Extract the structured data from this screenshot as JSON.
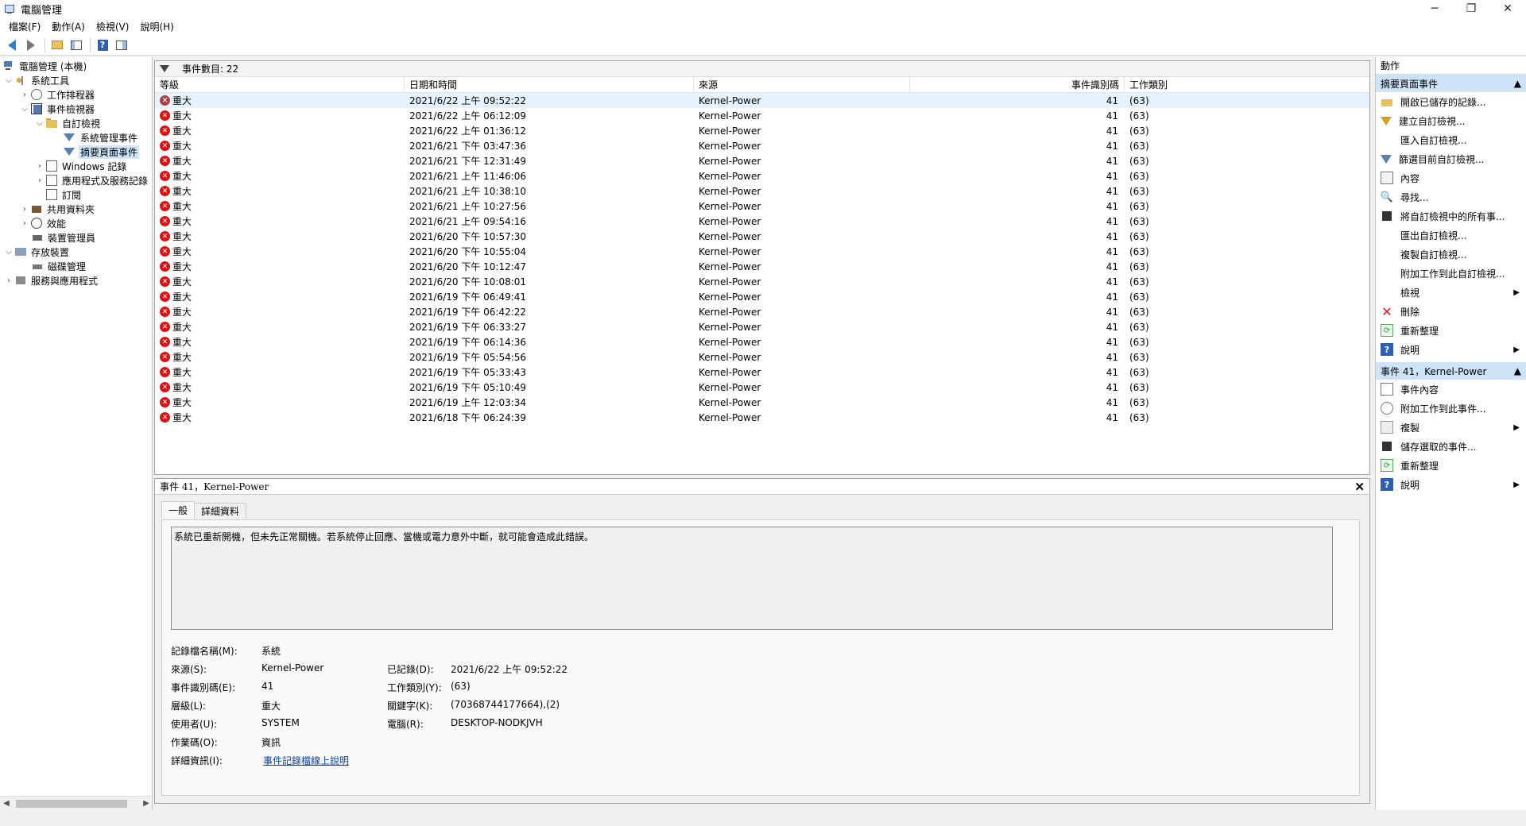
{
  "window": {
    "title": "電腦管理",
    "controls": [
      "─",
      "❐",
      "✕"
    ]
  },
  "menu": [
    "檔案(F)",
    "動作(A)",
    "檢視(V)",
    "說明(H)"
  ],
  "tree": [
    {
      "label": "電腦管理 (本機)",
      "chev": ""
    },
    {
      "label": "系統工具",
      "chev": "v"
    },
    {
      "label": "工作排程器",
      "chev": ">"
    },
    {
      "label": "事件檢視器",
      "chev": "v"
    },
    {
      "label": "自訂檢視",
      "chev": "v"
    },
    {
      "label": "系統管理事件",
      "chev": ""
    },
    {
      "label": "摘要頁面事件",
      "chev": ""
    },
    {
      "label": "Windows 記錄",
      "chev": ">"
    },
    {
      "label": "應用程式及服務記錄",
      "chev": ">"
    },
    {
      "label": "訂閱",
      "chev": ""
    },
    {
      "label": "共用資料夾",
      "chev": ">"
    },
    {
      "label": "效能",
      "chev": ">"
    },
    {
      "label": "裝置管理員",
      "chev": ""
    },
    {
      "label": "存放裝置",
      "chev": "v"
    },
    {
      "label": "磁碟管理",
      "chev": ""
    },
    {
      "label": "服務與應用程式",
      "chev": ">"
    }
  ],
  "list": {
    "count_label": "事件數目: 22",
    "columns": [
      "等級",
      "日期和時間",
      "來源",
      "事件識別碼",
      "工作類別"
    ],
    "rows": [
      {
        "level": "重大",
        "datetime": "2021/6/22 上午 09:52:22",
        "source": "Kernel-Power",
        "id": "41",
        "task": "(63)"
      },
      {
        "level": "重大",
        "datetime": "2021/6/22 上午 06:12:09",
        "source": "Kernel-Power",
        "id": "41",
        "task": "(63)"
      },
      {
        "level": "重大",
        "datetime": "2021/6/22 上午 01:36:12",
        "source": "Kernel-Power",
        "id": "41",
        "task": "(63)"
      },
      {
        "level": "重大",
        "datetime": "2021/6/21 下午 03:47:36",
        "source": "Kernel-Power",
        "id": "41",
        "task": "(63)"
      },
      {
        "level": "重大",
        "datetime": "2021/6/21 下午 12:31:49",
        "source": "Kernel-Power",
        "id": "41",
        "task": "(63)"
      },
      {
        "level": "重大",
        "datetime": "2021/6/21 上午 11:46:06",
        "source": "Kernel-Power",
        "id": "41",
        "task": "(63)"
      },
      {
        "level": "重大",
        "datetime": "2021/6/21 上午 10:38:10",
        "source": "Kernel-Power",
        "id": "41",
        "task": "(63)"
      },
      {
        "level": "重大",
        "datetime": "2021/6/21 上午 10:27:56",
        "source": "Kernel-Power",
        "id": "41",
        "task": "(63)"
      },
      {
        "level": "重大",
        "datetime": "2021/6/21 上午 09:54:16",
        "source": "Kernel-Power",
        "id": "41",
        "task": "(63)"
      },
      {
        "level": "重大",
        "datetime": "2021/6/20 下午 10:57:30",
        "source": "Kernel-Power",
        "id": "41",
        "task": "(63)"
      },
      {
        "level": "重大",
        "datetime": "2021/6/20 下午 10:55:04",
        "source": "Kernel-Power",
        "id": "41",
        "task": "(63)"
      },
      {
        "level": "重大",
        "datetime": "2021/6/20 下午 10:12:47",
        "source": "Kernel-Power",
        "id": "41",
        "task": "(63)"
      },
      {
        "level": "重大",
        "datetime": "2021/6/20 下午 10:08:01",
        "source": "Kernel-Power",
        "id": "41",
        "task": "(63)"
      },
      {
        "level": "重大",
        "datetime": "2021/6/19 下午 06:49:41",
        "source": "Kernel-Power",
        "id": "41",
        "task": "(63)"
      },
      {
        "level": "重大",
        "datetime": "2021/6/19 下午 06:42:22",
        "source": "Kernel-Power",
        "id": "41",
        "task": "(63)"
      },
      {
        "level": "重大",
        "datetime": "2021/6/19 下午 06:33:27",
        "source": "Kernel-Power",
        "id": "41",
        "task": "(63)"
      },
      {
        "level": "重大",
        "datetime": "2021/6/19 下午 06:14:36",
        "source": "Kernel-Power",
        "id": "41",
        "task": "(63)"
      },
      {
        "level": "重大",
        "datetime": "2021/6/19 下午 05:54:56",
        "source": "Kernel-Power",
        "id": "41",
        "task": "(63)"
      },
      {
        "level": "重大",
        "datetime": "2021/6/19 下午 05:33:43",
        "source": "Kernel-Power",
        "id": "41",
        "task": "(63)"
      },
      {
        "level": "重大",
        "datetime": "2021/6/19 下午 05:10:49",
        "source": "Kernel-Power",
        "id": "41",
        "task": "(63)"
      },
      {
        "level": "重大",
        "datetime": "2021/6/19 上午 12:03:34",
        "source": "Kernel-Power",
        "id": "41",
        "task": "(63)"
      },
      {
        "level": "重大",
        "datetime": "2021/6/18 下午 06:24:39",
        "source": "Kernel-Power",
        "id": "41",
        "task": "(63)"
      }
    ]
  },
  "detail": {
    "header": "事件 41，Kernel-Power",
    "tabs": [
      "一般",
      "詳細資料"
    ],
    "description": "系統已重新開機，但未先正常關機。若系統停止回應、當機或電力意外中斷，就可能會造成此錯誤。",
    "labels": {
      "log_name": "記錄檔名稱(M):",
      "source": "來源(S):",
      "event_id": "事件識別碼(E):",
      "level": "層級(L):",
      "user": "使用者(U):",
      "opcode": "作業碼(O):",
      "more_info": "詳細資訊(I):",
      "logged": "已記錄(D):",
      "task_category": "工作類別(Y):",
      "keywords": "關鍵字(K):",
      "computer": "電腦(R):"
    },
    "values": {
      "log_name": "系統",
      "source": "Kernel-Power",
      "event_id": "41",
      "level": "重大",
      "user": "SYSTEM",
      "opcode": "資訊",
      "more_info": "事件記錄檔線上說明",
      "logged": "2021/6/22 上午 09:52:22",
      "task_category": "(63)",
      "keywords": "(70368744177664),(2)",
      "computer": "DESKTOP-NODKJVH"
    }
  },
  "actions": {
    "title": "動作",
    "section1": "摘要頁面事件",
    "items1": [
      {
        "label": "開啟已儲存的記錄...",
        "icon": "open-icon",
        "sub": false
      },
      {
        "label": "建立自訂檢視...",
        "icon": "filter-create-icon",
        "sub": false
      },
      {
        "label": "匯入自訂檢視...",
        "icon": "",
        "sub": false
      },
      {
        "label": "篩選目前自訂檢視...",
        "icon": "filter-icon",
        "sub": false
      },
      {
        "label": "內容",
        "icon": "properties-icon",
        "sub": false
      },
      {
        "label": "尋找...",
        "icon": "find-icon",
        "sub": false
      },
      {
        "label": "將自訂檢視中的所有事...",
        "icon": "save-icon",
        "sub": false
      },
      {
        "label": "匯出自訂檢視...",
        "icon": "",
        "sub": false
      },
      {
        "label": "複製自訂檢視...",
        "icon": "",
        "sub": false
      },
      {
        "label": "附加工作到此自訂檢視...",
        "icon": "",
        "sub": false
      },
      {
        "label": "檢視",
        "icon": "",
        "sub": true
      },
      {
        "label": "刪除",
        "icon": "delete-icon",
        "sub": false
      },
      {
        "label": "重新整理",
        "icon": "refresh-icon",
        "sub": false
      },
      {
        "label": "說明",
        "icon": "help-icon",
        "sub": true
      }
    ],
    "section2": "事件 41，Kernel-Power",
    "items2": [
      {
        "label": "事件內容",
        "icon": "event-properties-icon",
        "sub": false
      },
      {
        "label": "附加工作到此事件...",
        "icon": "attach-task-icon",
        "sub": false
      },
      {
        "label": "複製",
        "icon": "copy-icon",
        "sub": true
      },
      {
        "label": "儲存選取的事件...",
        "icon": "save-icon",
        "sub": false
      },
      {
        "label": "重新整理",
        "icon": "refresh-icon",
        "sub": false
      },
      {
        "label": "說明",
        "icon": "help-icon",
        "sub": true
      }
    ]
  }
}
